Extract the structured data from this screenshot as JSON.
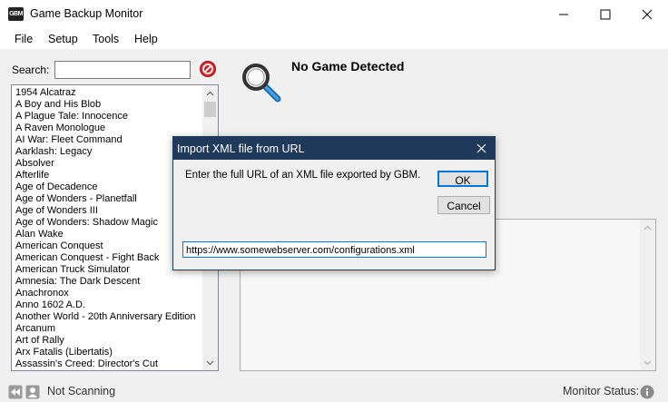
{
  "window": {
    "title": "Game Backup Monitor",
    "icon_text": "GBM"
  },
  "menu": [
    {
      "label": "File"
    },
    {
      "label": "Setup"
    },
    {
      "label": "Tools"
    },
    {
      "label": "Help"
    }
  ],
  "search": {
    "label": "Search:",
    "value": ""
  },
  "games": [
    "1954 Alcatraz",
    "A Boy and His Blob",
    "A Plague Tale: Innocence",
    "A Raven Monologue",
    "AI War: Fleet Command",
    "Aarklash: Legacy",
    "Absolver",
    "Afterlife",
    "Age of Decadence",
    "Age of Wonders - Planetfall",
    "Age of Wonders III",
    "Age of Wonders: Shadow Magic",
    "Alan Wake",
    "American Conquest",
    "American Conquest - Fight Back",
    "American Truck Simulator",
    "Amnesia: The Dark Descent",
    "Anachronox",
    "Anno 1602 A.D.",
    "Another World - 20th Anniversary Edition",
    "Arcanum",
    "Art of Rally",
    "Arx Fatalis (Libertatis)",
    "Assassin's Creed: Director's Cut"
  ],
  "detail": {
    "title": "No Game Detected"
  },
  "status": {
    "scanning": "Not Scanning",
    "monitor": "Monitor Status:"
  },
  "dialog": {
    "title": "Import XML file from URL",
    "message": "Enter the full URL of an XML file exported by GBM.",
    "ok_label": "OK",
    "cancel_label": "Cancel",
    "url_value": "https://www.somewebserver.com/configurations.xml"
  }
}
